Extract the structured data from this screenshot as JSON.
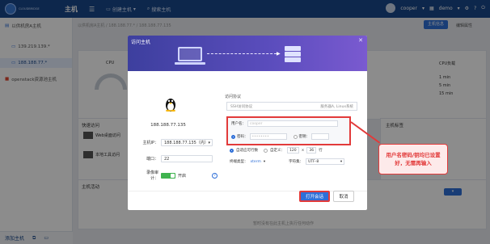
{
  "topbar": {
    "logo_text": "CLOUDBRIDGE",
    "title": "主机",
    "create_host": "创建主机",
    "search_host": "搜索主机",
    "user": "cooper",
    "space": "demo",
    "colors": {
      "bar": "#19478a",
      "accent": "#2e6fd8"
    }
  },
  "sidebar": {
    "items": [
      {
        "label": "以供机房A主机",
        "icon": "server-icon"
      },
      {
        "label": "139.219.139.*",
        "icon": "monitor-icon"
      },
      {
        "label": "188.188.77.*",
        "icon": "monitor-icon"
      },
      {
        "label": "openstack资源池主机",
        "icon": "cloud-icon"
      }
    ],
    "footer": {
      "label": "添加主机"
    }
  },
  "background": {
    "breadcrumb": "以供机房A主机 / 188.188.77.* / 188.188.77.135",
    "tab_host_info": "主机信息",
    "tab_edit": "编辑属性",
    "cpu_label": "CPU",
    "cpu_load_label": "CPU负载",
    "load_rows": [
      "1 min",
      "5 min",
      "15 min"
    ],
    "quick_access": "快速访问",
    "quick_items": [
      "Web桌面访问",
      "本地工具访问"
    ],
    "host_tags": "主机标签",
    "host_activity": "主机活动",
    "activity_empty": "暂时没有在此主机上执行任何动作"
  },
  "modal": {
    "title": "访问主机",
    "host_ip": "188.188.77.135",
    "host_ip_label": "主机IP：",
    "host_ip_value": "188.188.77.135（内）",
    "port_label": "端口：",
    "port_value": "22",
    "audit_label": "录像审计：",
    "audit_state": "开启",
    "protocol_section": "访问协议",
    "protocol_value": "SSH访问协议",
    "protocol_hint": "服务器A, Linux系统",
    "username_label": "用户名：",
    "username_placeholder": "cooper",
    "password_label": "密码：",
    "password_placeholder": "••••••••",
    "key_label": "密钥：",
    "adaptive_label": "自适应可行数",
    "custom_label": "自定义：",
    "cols": "120",
    "rows": "36",
    "rows_unit": "行",
    "terminal_label": "终端类型：",
    "terminal_value": "xterm",
    "charset_label": "字符集：",
    "charset_value": "UTF-8",
    "open_button": "打开会话",
    "cancel_button": "取消"
  },
  "callout": {
    "text": "用户名密码/钥均已设置好，无需再输入"
  }
}
